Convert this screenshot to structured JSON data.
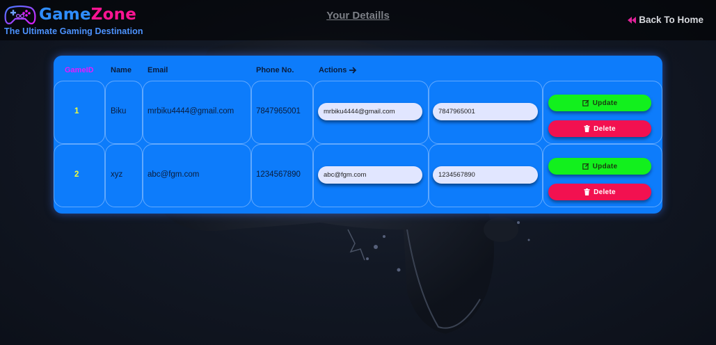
{
  "header": {
    "brand_part1": "Game",
    "brand_part2": "Zone",
    "tagline": "The Ultimate Gaming Destination",
    "page_title": "Your Detaills",
    "back_label": "Back To Home"
  },
  "table": {
    "columns": [
      "GameID",
      "Name",
      "Email",
      "Phone No.",
      "Actions"
    ],
    "rows": [
      {
        "id": "1",
        "name": "Biku",
        "email": "mrbiku4444@gmail.com",
        "phone": "7847965001",
        "email_input": "mrbiku4444@gmail.com",
        "phone_input": "7847965001",
        "update_label": "Update",
        "delete_label": "Delete"
      },
      {
        "id": "2",
        "name": "xyz",
        "email": "abc@fgm.com",
        "phone": "1234567890",
        "email_input": "abc@fgm.com",
        "phone_input": "1234567890",
        "update_label": "Update",
        "delete_label": "Delete"
      }
    ]
  },
  "icons": {
    "logo": "gamepad-icon",
    "back": "double-chevron-left-icon",
    "actions": "arrow-right-icon",
    "update": "edit-icon",
    "delete": "trash-icon"
  },
  "colors": {
    "card": "#0d7cfb",
    "brand_blue": "#2f8dff",
    "brand_pink": "#ff1493",
    "update_green": "#12f01d",
    "delete_red": "#f21150",
    "id_yellow": "#f4ff3a",
    "gameid_header": "#e51bff"
  }
}
